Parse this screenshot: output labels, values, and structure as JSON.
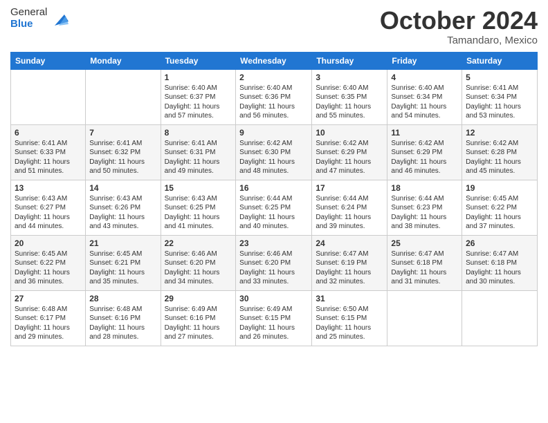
{
  "logo": {
    "general": "General",
    "blue": "Blue"
  },
  "header": {
    "month": "October 2024",
    "location": "Tamandaro, Mexico"
  },
  "days_of_week": [
    "Sunday",
    "Monday",
    "Tuesday",
    "Wednesday",
    "Thursday",
    "Friday",
    "Saturday"
  ],
  "weeks": [
    [
      {
        "day": "",
        "sunrise": "",
        "sunset": "",
        "daylight": ""
      },
      {
        "day": "",
        "sunrise": "",
        "sunset": "",
        "daylight": ""
      },
      {
        "day": "1",
        "sunrise": "Sunrise: 6:40 AM",
        "sunset": "Sunset: 6:37 PM",
        "daylight": "Daylight: 11 hours and 57 minutes."
      },
      {
        "day": "2",
        "sunrise": "Sunrise: 6:40 AM",
        "sunset": "Sunset: 6:36 PM",
        "daylight": "Daylight: 11 hours and 56 minutes."
      },
      {
        "day": "3",
        "sunrise": "Sunrise: 6:40 AM",
        "sunset": "Sunset: 6:35 PM",
        "daylight": "Daylight: 11 hours and 55 minutes."
      },
      {
        "day": "4",
        "sunrise": "Sunrise: 6:40 AM",
        "sunset": "Sunset: 6:34 PM",
        "daylight": "Daylight: 11 hours and 54 minutes."
      },
      {
        "day": "5",
        "sunrise": "Sunrise: 6:41 AM",
        "sunset": "Sunset: 6:34 PM",
        "daylight": "Daylight: 11 hours and 53 minutes."
      }
    ],
    [
      {
        "day": "6",
        "sunrise": "Sunrise: 6:41 AM",
        "sunset": "Sunset: 6:33 PM",
        "daylight": "Daylight: 11 hours and 51 minutes."
      },
      {
        "day": "7",
        "sunrise": "Sunrise: 6:41 AM",
        "sunset": "Sunset: 6:32 PM",
        "daylight": "Daylight: 11 hours and 50 minutes."
      },
      {
        "day": "8",
        "sunrise": "Sunrise: 6:41 AM",
        "sunset": "Sunset: 6:31 PM",
        "daylight": "Daylight: 11 hours and 49 minutes."
      },
      {
        "day": "9",
        "sunrise": "Sunrise: 6:42 AM",
        "sunset": "Sunset: 6:30 PM",
        "daylight": "Daylight: 11 hours and 48 minutes."
      },
      {
        "day": "10",
        "sunrise": "Sunrise: 6:42 AM",
        "sunset": "Sunset: 6:29 PM",
        "daylight": "Daylight: 11 hours and 47 minutes."
      },
      {
        "day": "11",
        "sunrise": "Sunrise: 6:42 AM",
        "sunset": "Sunset: 6:29 PM",
        "daylight": "Daylight: 11 hours and 46 minutes."
      },
      {
        "day": "12",
        "sunrise": "Sunrise: 6:42 AM",
        "sunset": "Sunset: 6:28 PM",
        "daylight": "Daylight: 11 hours and 45 minutes."
      }
    ],
    [
      {
        "day": "13",
        "sunrise": "Sunrise: 6:43 AM",
        "sunset": "Sunset: 6:27 PM",
        "daylight": "Daylight: 11 hours and 44 minutes."
      },
      {
        "day": "14",
        "sunrise": "Sunrise: 6:43 AM",
        "sunset": "Sunset: 6:26 PM",
        "daylight": "Daylight: 11 hours and 43 minutes."
      },
      {
        "day": "15",
        "sunrise": "Sunrise: 6:43 AM",
        "sunset": "Sunset: 6:25 PM",
        "daylight": "Daylight: 11 hours and 41 minutes."
      },
      {
        "day": "16",
        "sunrise": "Sunrise: 6:44 AM",
        "sunset": "Sunset: 6:25 PM",
        "daylight": "Daylight: 11 hours and 40 minutes."
      },
      {
        "day": "17",
        "sunrise": "Sunrise: 6:44 AM",
        "sunset": "Sunset: 6:24 PM",
        "daylight": "Daylight: 11 hours and 39 minutes."
      },
      {
        "day": "18",
        "sunrise": "Sunrise: 6:44 AM",
        "sunset": "Sunset: 6:23 PM",
        "daylight": "Daylight: 11 hours and 38 minutes."
      },
      {
        "day": "19",
        "sunrise": "Sunrise: 6:45 AM",
        "sunset": "Sunset: 6:22 PM",
        "daylight": "Daylight: 11 hours and 37 minutes."
      }
    ],
    [
      {
        "day": "20",
        "sunrise": "Sunrise: 6:45 AM",
        "sunset": "Sunset: 6:22 PM",
        "daylight": "Daylight: 11 hours and 36 minutes."
      },
      {
        "day": "21",
        "sunrise": "Sunrise: 6:45 AM",
        "sunset": "Sunset: 6:21 PM",
        "daylight": "Daylight: 11 hours and 35 minutes."
      },
      {
        "day": "22",
        "sunrise": "Sunrise: 6:46 AM",
        "sunset": "Sunset: 6:20 PM",
        "daylight": "Daylight: 11 hours and 34 minutes."
      },
      {
        "day": "23",
        "sunrise": "Sunrise: 6:46 AM",
        "sunset": "Sunset: 6:20 PM",
        "daylight": "Daylight: 11 hours and 33 minutes."
      },
      {
        "day": "24",
        "sunrise": "Sunrise: 6:47 AM",
        "sunset": "Sunset: 6:19 PM",
        "daylight": "Daylight: 11 hours and 32 minutes."
      },
      {
        "day": "25",
        "sunrise": "Sunrise: 6:47 AM",
        "sunset": "Sunset: 6:18 PM",
        "daylight": "Daylight: 11 hours and 31 minutes."
      },
      {
        "day": "26",
        "sunrise": "Sunrise: 6:47 AM",
        "sunset": "Sunset: 6:18 PM",
        "daylight": "Daylight: 11 hours and 30 minutes."
      }
    ],
    [
      {
        "day": "27",
        "sunrise": "Sunrise: 6:48 AM",
        "sunset": "Sunset: 6:17 PM",
        "daylight": "Daylight: 11 hours and 29 minutes."
      },
      {
        "day": "28",
        "sunrise": "Sunrise: 6:48 AM",
        "sunset": "Sunset: 6:16 PM",
        "daylight": "Daylight: 11 hours and 28 minutes."
      },
      {
        "day": "29",
        "sunrise": "Sunrise: 6:49 AM",
        "sunset": "Sunset: 6:16 PM",
        "daylight": "Daylight: 11 hours and 27 minutes."
      },
      {
        "day": "30",
        "sunrise": "Sunrise: 6:49 AM",
        "sunset": "Sunset: 6:15 PM",
        "daylight": "Daylight: 11 hours and 26 minutes."
      },
      {
        "day": "31",
        "sunrise": "Sunrise: 6:50 AM",
        "sunset": "Sunset: 6:15 PM",
        "daylight": "Daylight: 11 hours and 25 minutes."
      },
      {
        "day": "",
        "sunrise": "",
        "sunset": "",
        "daylight": ""
      },
      {
        "day": "",
        "sunrise": "",
        "sunset": "",
        "daylight": ""
      }
    ]
  ]
}
